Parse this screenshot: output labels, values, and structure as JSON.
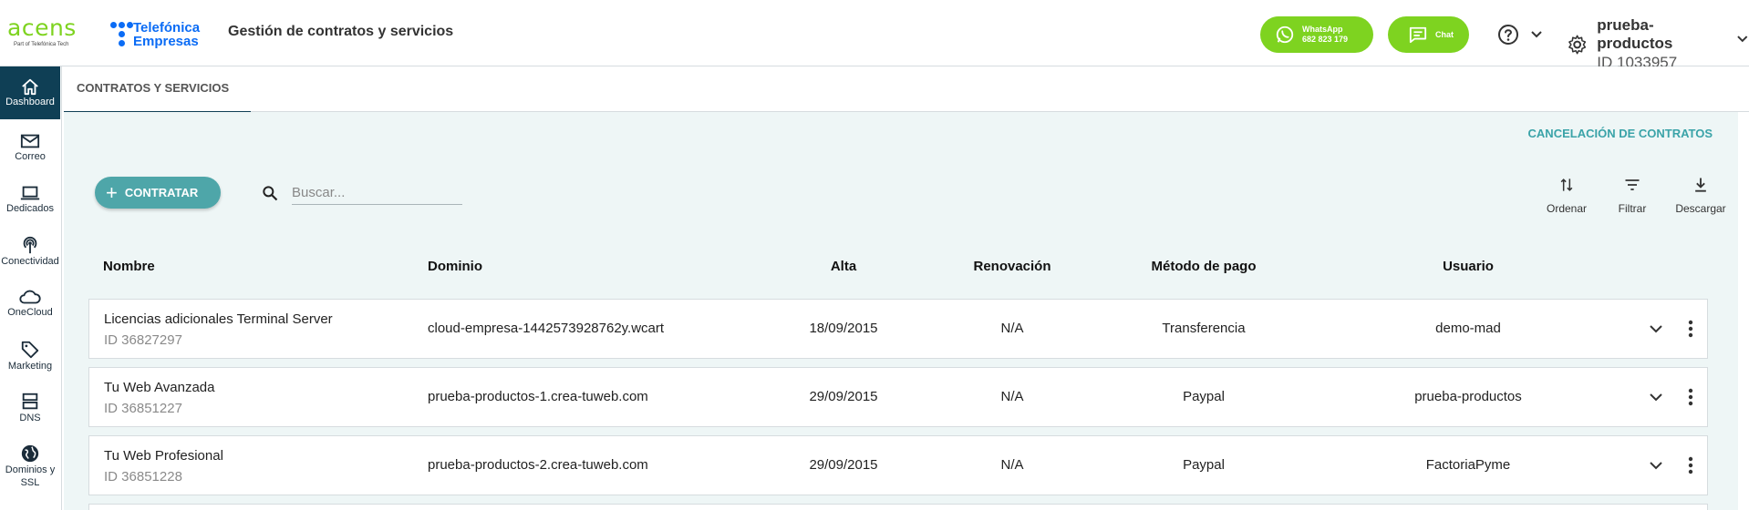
{
  "header": {
    "brand": "acens",
    "brand_sub": "Part of Telefónica Tech",
    "partner_line1": "Telefónica",
    "partner_line2": "Empresas",
    "app_title": "Gestión de contratos y servicios",
    "whatsapp_label": "WhatsApp",
    "whatsapp_number": "682 823 179",
    "chat_label": "Chat",
    "account_name": "prueba-productos",
    "account_id": "ID 1033957",
    "accent_green": "#7ed320"
  },
  "sidebar": {
    "items": [
      {
        "label": "Dashboard",
        "icon": "home-icon",
        "active": true
      },
      {
        "label": "Correo",
        "icon": "mail-icon"
      },
      {
        "label": "Dedicados",
        "icon": "laptop-icon"
      },
      {
        "label": "Conectividad",
        "icon": "signal-icon"
      },
      {
        "label": "OneCloud",
        "icon": "cloud-icon"
      },
      {
        "label": "Marketing",
        "icon": "tag-icon"
      },
      {
        "label": "DNS",
        "icon": "server-icon"
      },
      {
        "label": "Dominios y SSL",
        "icon": "globe-icon"
      }
    ]
  },
  "tabs": {
    "active_label": "CONTRATOS Y SERVICIOS"
  },
  "main": {
    "cancel_link": "CANCELACIÓN DE CONTRATOS",
    "contratar_label": "CONTRATAR",
    "search_placeholder": "Buscar...",
    "tools": {
      "sort": "Ordenar",
      "filter": "Filtrar",
      "download": "Descargar"
    },
    "columns": [
      "Nombre",
      "Dominio",
      "Alta",
      "Renovación",
      "Método de pago",
      "Usuario"
    ],
    "rows": [
      {
        "name": "Licencias adicionales Terminal Server",
        "id": "ID 36827297",
        "domain": "cloud-empresa-1442573928762y.wcart",
        "alta": "18/09/2015",
        "renovacion": "N/A",
        "pago": "Transferencia",
        "usuario": "demo-mad"
      },
      {
        "name": "Tu Web Avanzada",
        "id": "ID 36851227",
        "domain": "prueba-productos-1.crea-tuweb.com",
        "alta": "29/09/2015",
        "renovacion": "N/A",
        "pago": "Paypal",
        "usuario": "prueba-productos"
      },
      {
        "name": "Tu Web Profesional",
        "id": "ID 36851228",
        "domain": "prueba-productos-2.crea-tuweb.com",
        "alta": "29/09/2015",
        "renovacion": "N/A",
        "pago": "Paypal",
        "usuario": "FactoriaPyme"
      }
    ]
  }
}
